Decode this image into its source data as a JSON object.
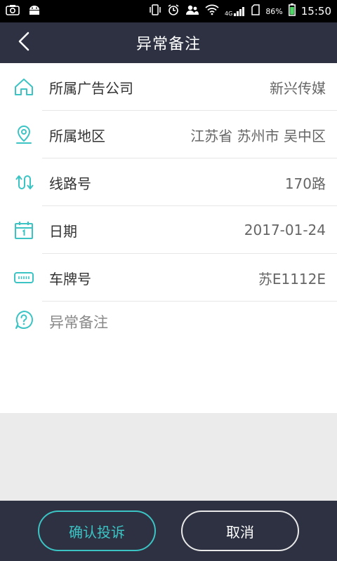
{
  "status_bar": {
    "network": "4G",
    "battery": "86%",
    "time": "15:50",
    "icons": [
      "screenshot-icon",
      "android-icon",
      "vibrate-icon",
      "alarm-icon",
      "contacts-icon",
      "wifi-icon",
      "signal-icon",
      "battery-icon"
    ]
  },
  "header": {
    "title": "异常备注",
    "back_icon": "chevron-left-icon"
  },
  "form": {
    "rows": [
      {
        "label": "所属广告公司",
        "value": "新兴传媒",
        "icon": "home-icon"
      },
      {
        "label": "所属地区",
        "value": "江苏省 苏州市 吴中区",
        "icon": "location-pin-icon"
      },
      {
        "label": "线路号",
        "value": "170路",
        "icon": "route-icon"
      },
      {
        "label": "日期",
        "value": "2017-01-24",
        "icon": "calendar-icon"
      },
      {
        "label": "车牌号",
        "value": "苏E1112E",
        "icon": "license-plate-icon"
      }
    ],
    "remark": {
      "placeholder": "异常备注",
      "icon": "question-icon"
    }
  },
  "actions": {
    "confirm_label": "确认投诉",
    "cancel_label": "取消"
  },
  "colors": {
    "accent": "#3cc4c4",
    "header_bg": "#2d3142",
    "page_bg": "#ebebeb"
  }
}
